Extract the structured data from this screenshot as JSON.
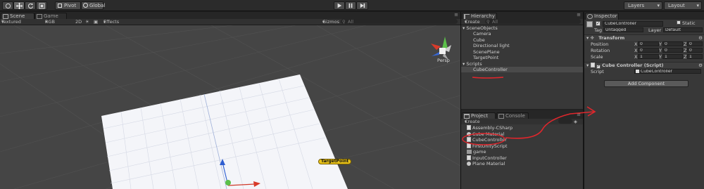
{
  "toolbar": {
    "pivot_label": "Pivot",
    "global_label": "Global",
    "layers_label": "Layers",
    "layout_label": "Layout"
  },
  "scene": {
    "tab_scene": "Scene",
    "tab_game": "Game",
    "shading_mode": "Textured",
    "render_mode": "RGB",
    "mode_2d": "2D",
    "effects_label": "Effects",
    "gizmos_label": "Gizmos",
    "search_placeholder": "All",
    "persp_label": "Persp",
    "target_point_label": "TargetPoint"
  },
  "hierarchy": {
    "tab_label": "Hierarchy",
    "create_label": "Create",
    "search_placeholder": "All",
    "groups": [
      {
        "label": "SceneObjects",
        "children": [
          "Camera",
          "Cube",
          "Directional light",
          "ScenePlane",
          "TargetPoint"
        ]
      },
      {
        "label": "Scripts",
        "children": [
          "CubeController"
        ]
      }
    ]
  },
  "project": {
    "tab_project": "Project",
    "tab_console": "Console",
    "create_label": "Create",
    "items": [
      "Assembly-CSharp",
      "Cube Material",
      "CubeController",
      "FirstUnityScript",
      "game",
      "InputController",
      "Plane Material"
    ]
  },
  "inspector": {
    "tab_label": "Inspector",
    "object_name": "CubeController",
    "static_label": "Static",
    "tag_label": "Tag",
    "tag_value": "Untagged",
    "layer_label": "Layer",
    "layer_value": "Default",
    "transform_title": "Transform",
    "position_label": "Position",
    "rotation_label": "Rotation",
    "scale_label": "Scale",
    "axis_x": "X",
    "axis_y": "Y",
    "axis_z": "Z",
    "position": [
      "0",
      "0",
      "0"
    ],
    "rotation": [
      "0",
      "0",
      "0"
    ],
    "scale": [
      "1",
      "1",
      "1"
    ],
    "script_component_title": "Cube Controller (Script)",
    "script_label": "Script",
    "script_value": "CubeController",
    "add_component_label": "Add Component"
  },
  "colors": {
    "annotation": "#e0262c",
    "selection": "#3d6fa8",
    "target_label_bg": "#e8c21a"
  }
}
